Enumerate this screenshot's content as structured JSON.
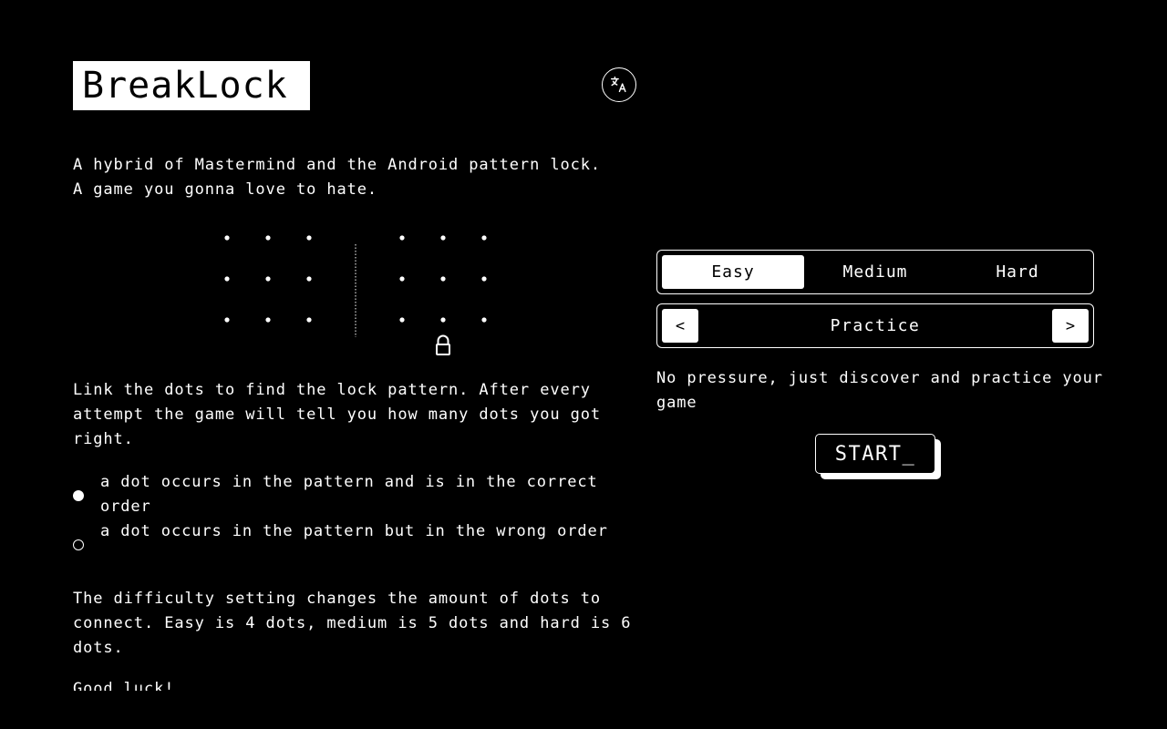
{
  "app": {
    "title": "BreakLock",
    "language_button": "translate-icon"
  },
  "intro": "A hybrid of Mastermind and the Android pattern lock. A game you gonna love to hate.",
  "demo": {
    "grid_rows": 3,
    "grid_cols": 3,
    "lock_icon": "lock-icon"
  },
  "instructions": "Link the dots to find the lock pattern. After every attempt the game will tell you how many dots you got right.",
  "legend": [
    {
      "marker": "filled-dot",
      "text": "a dot occurs in the pattern and is in the correct order"
    },
    {
      "marker": "hollow-dot",
      "text": "a dot occurs in the pattern but in the wrong order"
    }
  ],
  "difficulty_text": "The difficulty setting changes the amount of dots to connect. Easy is 4 dots, medium is 5 dots and hard is 6 dots.",
  "closing": "Good luck!",
  "difficulty": {
    "options": [
      "Easy",
      "Medium",
      "Hard"
    ],
    "selected": "Easy"
  },
  "mode": {
    "prev": "<",
    "label": "Practice",
    "next": ">",
    "description": "No pressure, just discover and practice your game"
  },
  "start_button": "START_",
  "colors": {
    "background": "#000000",
    "foreground": "#ffffff"
  }
}
